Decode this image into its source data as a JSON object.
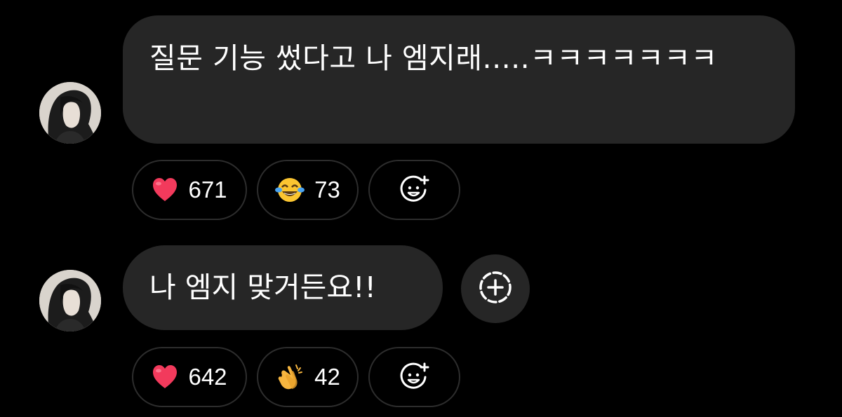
{
  "messages": [
    {
      "text": "질문 기능 썼다고 나 엠지래.....ㅋㅋㅋㅋㅋㅋㅋ",
      "reactions": [
        {
          "emoji": "red-heart",
          "count": "671"
        },
        {
          "emoji": "face-with-tears-of-joy",
          "count": "73"
        }
      ],
      "add_reaction_icon": "add-emoji-icon"
    },
    {
      "text": "나 엠지 맞거든요!!",
      "reactions": [
        {
          "emoji": "red-heart",
          "count": "642"
        },
        {
          "emoji": "clapping-hands",
          "count": "42"
        }
      ],
      "add_reaction_icon": "add-emoji-icon",
      "more_action_icon": "dashed-plus-circle-icon"
    }
  ],
  "colors": {
    "background": "#000000",
    "bubble": "#262626",
    "chip_border": "#2d2d2d",
    "heart": "#f23a5c"
  }
}
